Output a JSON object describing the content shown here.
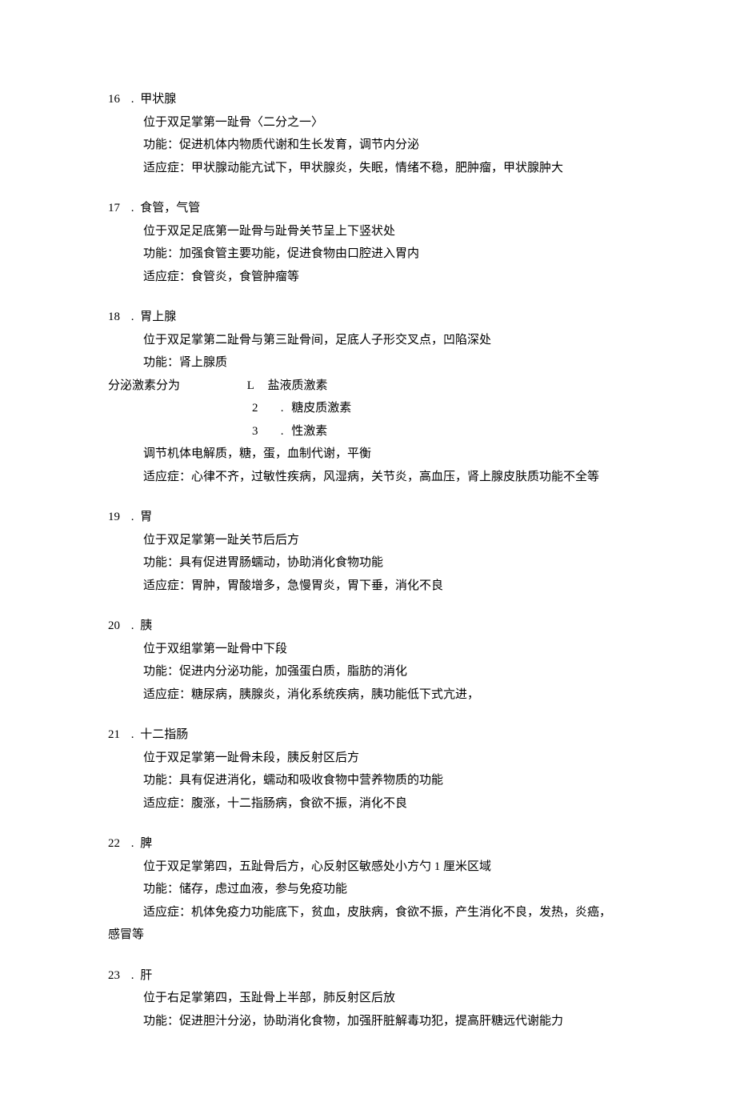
{
  "entries": [
    {
      "num": "16",
      "title": "甲状腺",
      "lines": [
        "位于双足掌第一趾骨〈二分之一〉",
        "功能：促进机体内物质代谢和生长发育，调节内分泌",
        "适应症：甲状腺动能亢试下，甲状腺炎，失眠，情绪不稳，肥肿瘤，甲状腺肿大"
      ]
    },
    {
      "num": "17",
      "title": "食管，气管",
      "lines": [
        "位于双足足底第一趾骨与趾骨关节呈上下竖状处",
        "功能：加强食管主要功能，促进食物由口腔进入胃内",
        "适应症：食管炎，食管肿瘤等"
      ]
    },
    {
      "num": "18",
      "title": "胃上腺",
      "pre_lines": [
        "位于双足掌第二趾骨与第三趾骨间，足底人子形交叉点，凹陷深处",
        "功能：肾上腺质"
      ],
      "secretion_label": "分泌激素分为",
      "sub_items": [
        {
          "n": "L",
          "t": "盐液质激素"
        },
        {
          "n": "2",
          "t": "糖皮质激素"
        },
        {
          "n": "3",
          "t": "性激素"
        }
      ],
      "post_lines": [
        "调节机体电解质，糖，蛋，血制代谢，平衡",
        "适应症：心律不齐，过敏性疾病，风湿病，关节炎，高血压，肾上腺皮肤质功能不全等"
      ]
    },
    {
      "num": "19",
      "title": "胃",
      "lines": [
        "位于双足掌第一趾关节后后方",
        "功能：具有促进胃肠蠕动，协助消化食物功能",
        "适应症：胃肿，胃酸增多，急慢胃炎，胃下垂，消化不良"
      ]
    },
    {
      "num": "20",
      "title": "胰",
      "lines": [
        "位于双组掌第一趾骨中下段",
        "功能：促进内分泌功能，加强蛋白质，脂肪的消化",
        "适应症：糖尿病，胰腺炎，消化系统疾病，胰功能低下式亢进，"
      ]
    },
    {
      "num": "21",
      "title": "十二指肠",
      "lines": [
        "位于双足掌第一趾骨未段，胰反射区后方",
        "功能：具有促进消化，蠕动和吸收食物中营养物质的功能",
        "适应症：腹涨，十二指肠病，食欲不振，消化不良"
      ]
    },
    {
      "num": "22",
      "title": "脾",
      "lines": [
        "位于双足掌第四，五趾骨后方，心反射区敏感处小方勺 1 厘米区域",
        "功能：储存，虑过血液，参与免疫功能",
        "适应症：机体免疫力功能底下，贫血，皮肤病，食欲不振，产生消化不良，发热，炎癌，"
      ],
      "tail_noindent": "感冒等"
    },
    {
      "num": "23",
      "title": "肝",
      "lines": [
        "位于右足掌第四，玉趾骨上半部，肺反射区后放",
        "功能：促进胆汁分泌，协助消化食物，加强肝脏解毒功犯，提高肝糖远代谢能力"
      ]
    }
  ],
  "dot": "."
}
